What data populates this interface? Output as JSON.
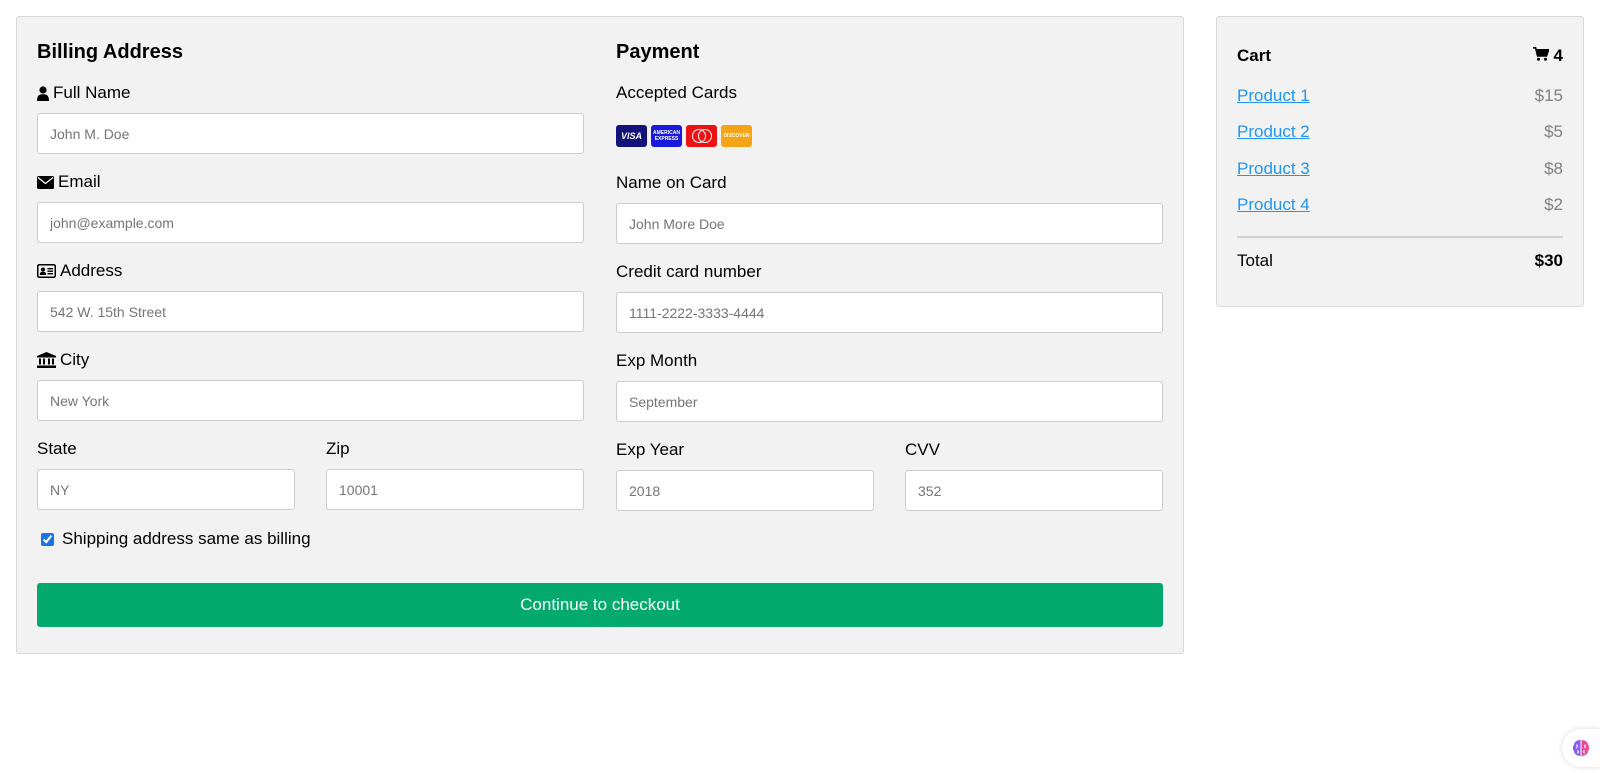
{
  "billing": {
    "title": "Billing Address",
    "full_name": {
      "label": "Full Name",
      "placeholder": "John M. Doe"
    },
    "email": {
      "label": "Email",
      "placeholder": "john@example.com"
    },
    "address": {
      "label": "Address",
      "placeholder": "542 W. 15th Street"
    },
    "city": {
      "label": "City",
      "placeholder": "New York"
    },
    "state": {
      "label": "State",
      "placeholder": "NY"
    },
    "zip": {
      "label": "Zip",
      "placeholder": "10001"
    }
  },
  "payment": {
    "title": "Payment",
    "accepted_cards_label": "Accepted Cards",
    "cards": [
      {
        "name": "VISA",
        "icon": "visa-card-icon",
        "color": "#12127a"
      },
      {
        "name": "AMERICAN EXPRESS",
        "icon": "amex-card-icon",
        "color": "#1a1adf"
      },
      {
        "name": "mastercard",
        "icon": "mastercard-icon",
        "color": "#ee1111"
      },
      {
        "name": "DISCOVER",
        "icon": "discover-card-icon",
        "color": "#f5a416"
      }
    ],
    "name_on_card": {
      "label": "Name on Card",
      "placeholder": "John More Doe"
    },
    "card_number": {
      "label": "Credit card number",
      "placeholder": "1111-2222-3333-4444"
    },
    "exp_month": {
      "label": "Exp Month",
      "placeholder": "September"
    },
    "exp_year": {
      "label": "Exp Year",
      "placeholder": "2018"
    },
    "cvv": {
      "label": "CVV",
      "placeholder": "352"
    }
  },
  "shipping_same": {
    "label": "Shipping address same as billing",
    "checked": true
  },
  "checkout_button": {
    "label": "Continue to checkout",
    "color": "#04aa6d"
  },
  "cart": {
    "title": "Cart",
    "count": "4",
    "items": [
      {
        "name": "Product 1",
        "price": "$15"
      },
      {
        "name": "Product 2",
        "price": "$5"
      },
      {
        "name": "Product 3",
        "price": "$8"
      },
      {
        "name": "Product 4",
        "price": "$2"
      }
    ],
    "total_label": "Total",
    "total_value": "$30",
    "link_color": "#2196f3"
  }
}
